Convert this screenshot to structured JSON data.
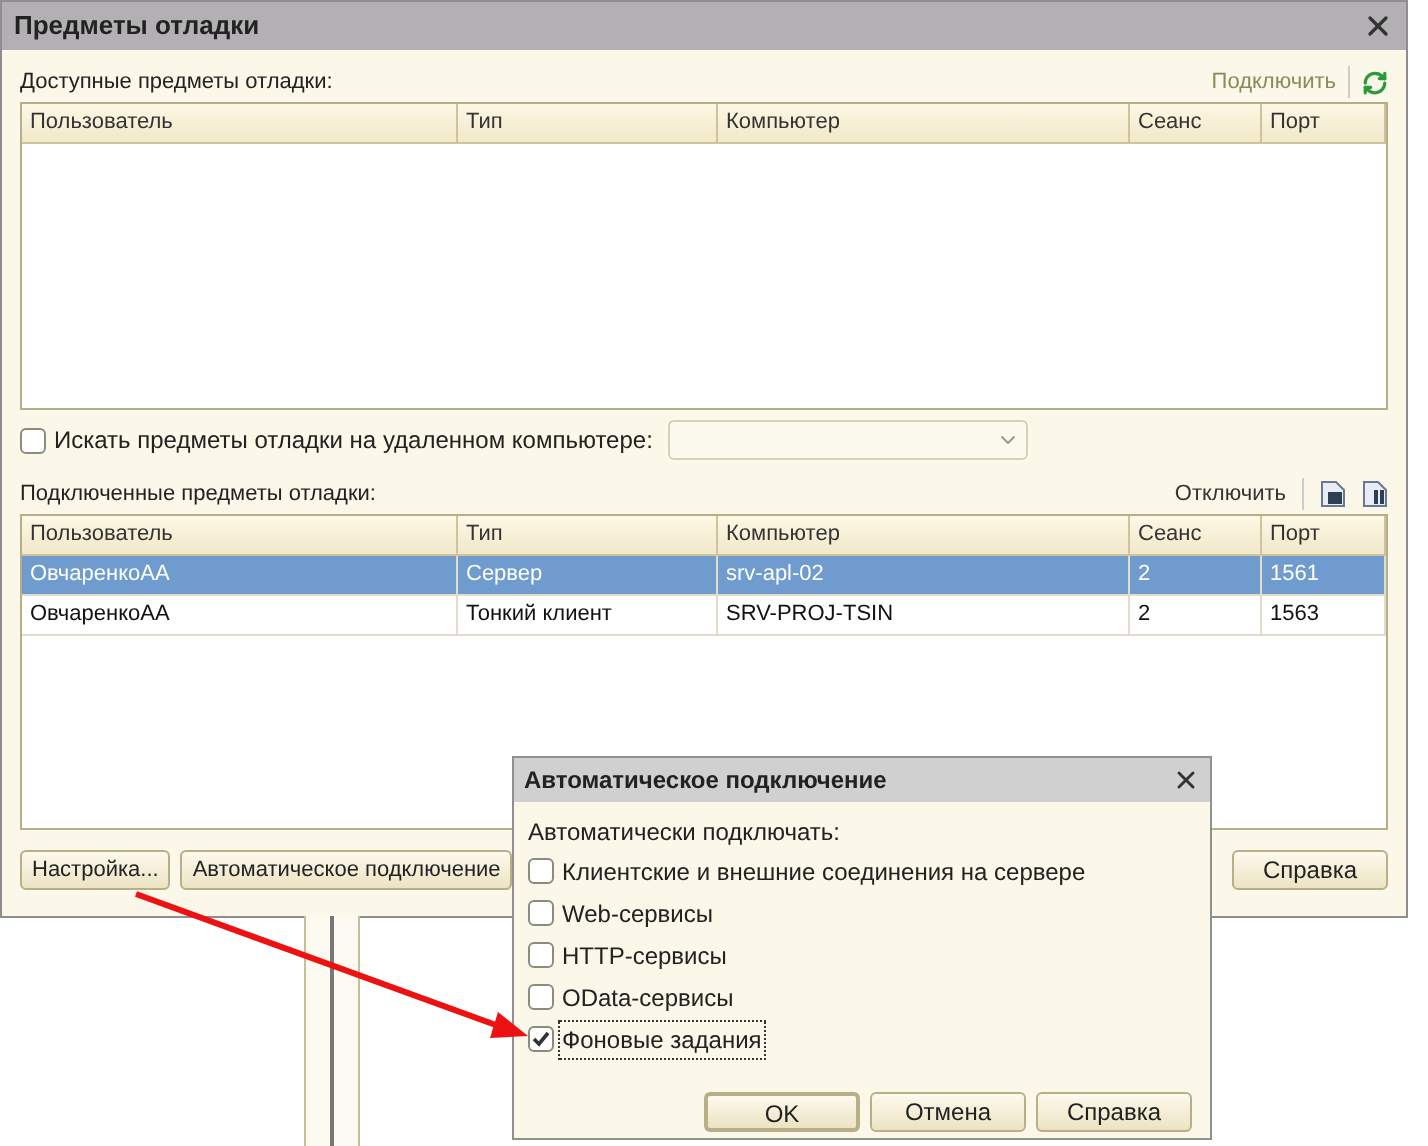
{
  "window": {
    "title": "Предметы отладки"
  },
  "available": {
    "label": "Доступные предметы отладки:",
    "connect_link": "Подключить",
    "columns": [
      "Пользователь",
      "Тип",
      "Компьютер",
      "Сеанс",
      "Порт"
    ]
  },
  "remote_search": {
    "label": "Искать предметы отладки на удаленном компьютере:",
    "checked": false
  },
  "connected": {
    "label": "Подключенные предметы отладки:",
    "disconnect_link": "Отключить",
    "columns": [
      "Пользователь",
      "Тип",
      "Компьютер",
      "Сеанс",
      "Порт"
    ],
    "rows": [
      {
        "cells": [
          "ОвчаренкоАА",
          "Сервер",
          "srv-apl-02",
          "2",
          "1561"
        ],
        "selected": true
      },
      {
        "cells": [
          "ОвчаренкоАА",
          "Тонкий клиент",
          "SRV-PROJ-TSIN",
          "2",
          "1563"
        ],
        "selected": false
      }
    ]
  },
  "left_buttons": [
    "Настройка...",
    "Автоматическое подключение"
  ],
  "right_buttons": [
    "Справка"
  ],
  "auto_dialog": {
    "title": "Автоматическое подключение",
    "prompt": "Автоматически подключать:",
    "options": [
      {
        "label": "Клиентские и внешние соединения на сервере",
        "checked": false,
        "focused": false
      },
      {
        "label": "Web-сервисы",
        "checked": false,
        "focused": false
      },
      {
        "label": "HTTP-сервисы",
        "checked": false,
        "focused": false
      },
      {
        "label": "OData-сервисы",
        "checked": false,
        "focused": false
      },
      {
        "label": "Фоновые задания",
        "checked": true,
        "focused": true
      }
    ],
    "buttons": [
      "OK",
      "Отмена",
      "Справка"
    ]
  }
}
